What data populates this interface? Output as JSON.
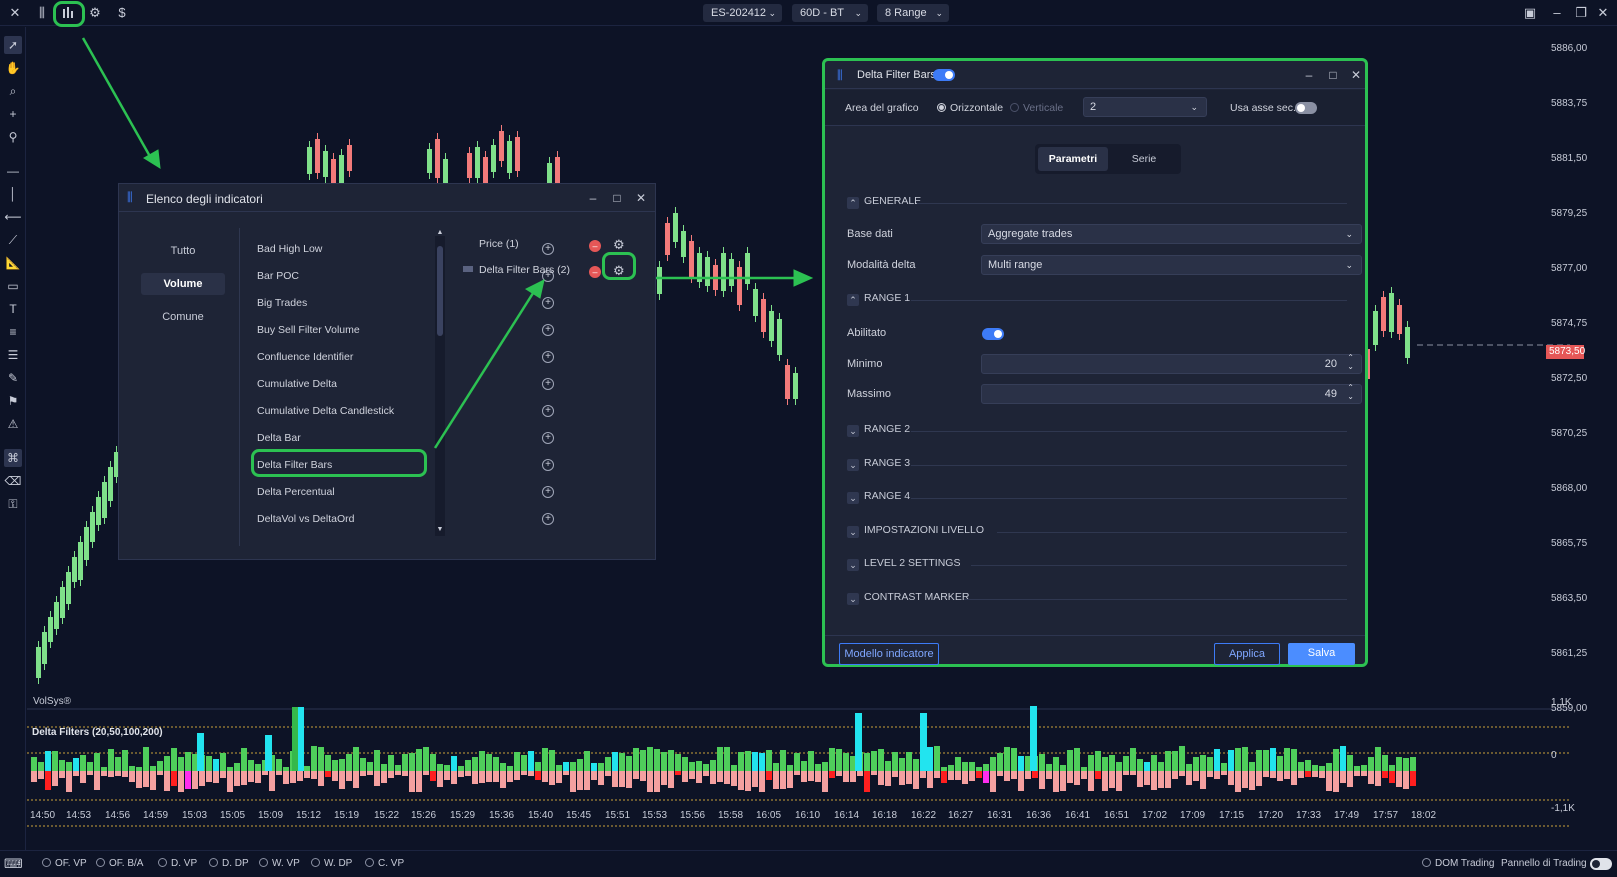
{
  "topbar": {
    "symbol": "ES-202412",
    "timeframe": "60D - BT",
    "range": "8 Range"
  },
  "chart": {
    "watermark": "VolSys®",
    "price_labels": [
      "5886,00",
      "5883,75",
      "5881,50",
      "5879,25",
      "5877,00",
      "5874,75",
      "5872,50",
      "5870,25",
      "5868,00",
      "5865,75",
      "5863,50",
      "5861,25",
      "5859,00"
    ],
    "current_price": "5873,50",
    "indicator_label": "Delta Filters (20,50,100,200)",
    "indicator_scale": [
      "1,1K",
      "0",
      "-1,1K"
    ],
    "time_labels": [
      "14:50",
      "14:53",
      "14:56",
      "14:59",
      "15:03",
      "15:05",
      "15:09",
      "15:12",
      "15:19",
      "15:22",
      "15:26",
      "15:29",
      "15:36",
      "15:40",
      "15:45",
      "15:51",
      "15:53",
      "15:56",
      "15:58",
      "16:05",
      "16:10",
      "16:14",
      "16:18",
      "16:22",
      "16:27",
      "16:31",
      "16:36",
      "16:41",
      "16:51",
      "17:02",
      "17:09",
      "17:15",
      "17:20",
      "17:33",
      "17:49",
      "17:57",
      "18:02"
    ]
  },
  "bottombar": {
    "items": [
      "OF. VP",
      "OF. B/A",
      "D. VP",
      "D. DP",
      "W. VP",
      "W. DP",
      "C. VP"
    ],
    "dom_trading": "DOM Trading",
    "pannello": "Pannello di Trading"
  },
  "indicators_panel": {
    "title": "Elenco degli indicatori",
    "tabs": [
      "Tutto",
      "Volume",
      "Comune"
    ],
    "active_tab": "Volume",
    "items": [
      "Bad High Low",
      "Bar POC",
      "Big Trades",
      "Buy Sell Filter Volume",
      "Confluence Identifier",
      "Cumulative Delta",
      "Cumulative Delta Candlestick",
      "Delta Bar",
      "Delta Filter Bars",
      "Delta Percentual",
      "DeltaVol vs DeltaOrd"
    ],
    "applied": [
      "Price (1)",
      "Delta Filter Bars (2)"
    ]
  },
  "settings_panel": {
    "title": "Delta Filter Bars",
    "area_label": "Area del grafico",
    "opt_horizontal": "Orizzontale",
    "opt_vertical": "Verticale",
    "area_value": "2",
    "secondary_axis": "Usa asse sec.",
    "tab_params": "Parametri",
    "tab_series": "Serie",
    "sec_generale": "GENERALE",
    "base_dati_label": "Base dati",
    "base_dati_value": "Aggregate trades",
    "modalita_label": "Modalità delta",
    "modalita_value": "Multi range",
    "sec_range1": "RANGE 1",
    "abilitato_label": "Abilitato",
    "minimo_label": "Minimo",
    "minimo_value": "20",
    "massimo_label": "Massimo",
    "massimo_value": "49",
    "sections": [
      "RANGE 2",
      "RANGE 3",
      "RANGE 4",
      "IMPOSTAZIONI LIVELLO",
      "LEVEL 2 SETTINGS",
      "CONTRAST MARKER"
    ],
    "btn_model": "Modello indicatore",
    "btn_apply": "Applica",
    "btn_save": "Salva"
  },
  "colors": {
    "bg": "#0d1326",
    "panel": "#1e2436",
    "bull": "#7fe08a",
    "bear": "#f27a7a",
    "highlight": "#2cc152",
    "accent": "#3d7bf7"
  }
}
